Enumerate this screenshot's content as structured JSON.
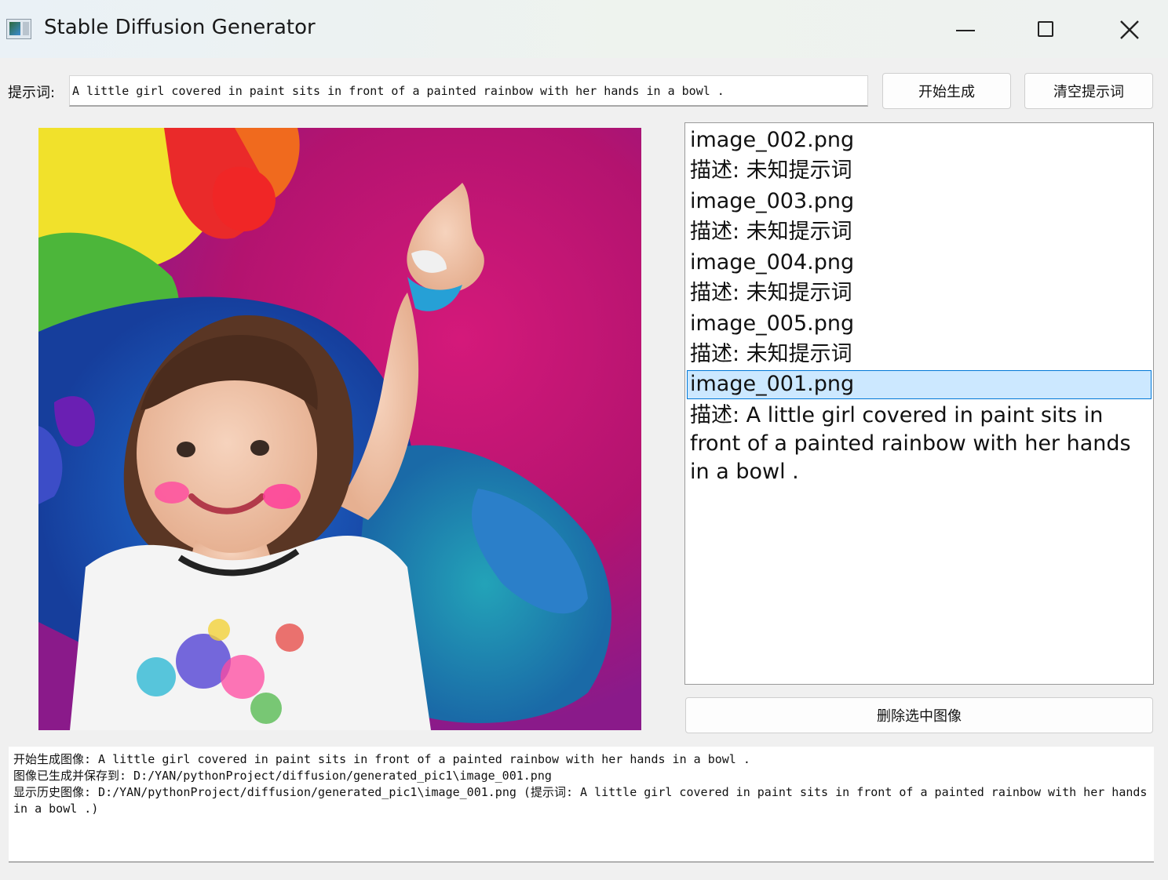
{
  "window": {
    "title": "Stable Diffusion Generator",
    "minimize_icon": "minimize-icon",
    "maximize_icon": "maximize-icon",
    "close_icon": "close-icon"
  },
  "prompt": {
    "label": "提示词:",
    "value": "A little girl covered in paint sits in front of a painted rainbow with her hands in a bowl ."
  },
  "buttons": {
    "start": "开始生成",
    "clear": "清空提示词",
    "delete": "删除选中图像"
  },
  "history": {
    "items": [
      {
        "name": "image_002.png",
        "desc": "描述: 未知提示词"
      },
      {
        "name": "image_003.png",
        "desc": "描述: 未知提示词"
      },
      {
        "name": "image_004.png",
        "desc": "描述: 未知提示词"
      },
      {
        "name": "image_005.png",
        "desc": "描述: 未知提示词"
      },
      {
        "name": "image_001.png",
        "desc": "描述: A little girl covered in paint sits in front of a painted rainbow with her hands in a bowl .",
        "selected": true
      }
    ]
  },
  "log": {
    "lines": [
      "开始生成图像: A little girl covered in paint sits in front of a painted rainbow with her hands in a bowl .",
      "图像已生成并保存到: D:/YAN/pythonProject/diffusion/generated_pic1\\image_001.png",
      "显示历史图像: D:/YAN/pythonProject/diffusion/generated_pic1\\image_001.png (提示词: A little girl covered in paint sits in front of a painted rainbow with her hands in a bowl .)"
    ]
  },
  "colors": {
    "selection_bg": "#cce8ff",
    "selection_border": "#0078d7"
  }
}
